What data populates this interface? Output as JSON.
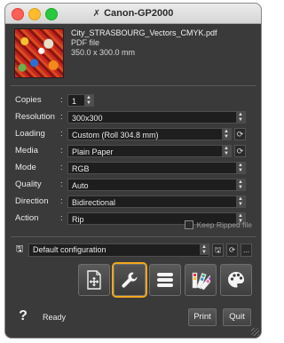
{
  "window": {
    "title": "Canon-GP2000"
  },
  "file": {
    "name": "City_STRASBOURG_Vectors_CMYK.pdf",
    "type": "PDF file",
    "size": "350.0 x 300.0 mm"
  },
  "settings": {
    "copies": {
      "label": "Copies",
      "value": "1"
    },
    "resolution": {
      "label": "Resolution",
      "value": "300x300"
    },
    "loading": {
      "label": "Loading",
      "value": "Custom (Roll 304.8 mm)"
    },
    "media": {
      "label": "Media",
      "value": "Plain Paper"
    },
    "mode": {
      "label": "Mode",
      "value": "RGB"
    },
    "quality": {
      "label": "Quality",
      "value": "Auto"
    },
    "direction": {
      "label": "Direction",
      "value": "Bidirectional"
    },
    "action": {
      "label": "Action",
      "value": "Rip"
    },
    "colon": ":"
  },
  "keep_ripped": {
    "label": "Keep Ripped file",
    "checked": false
  },
  "configuration": {
    "value": "Default configuration",
    "more_label": "..."
  },
  "tools": [
    {
      "name": "add-file-tool",
      "icon": "add-file-icon",
      "selected": false
    },
    {
      "name": "settings-tool",
      "icon": "wrench-icon",
      "selected": true
    },
    {
      "name": "queue-tool",
      "icon": "stack-icon",
      "selected": false
    },
    {
      "name": "color-swatch-tool",
      "icon": "swatch-icon",
      "selected": false
    },
    {
      "name": "palette-tool",
      "icon": "palette-icon",
      "selected": false
    }
  ],
  "footer": {
    "help": "?",
    "status": "Ready",
    "print_label": "Print",
    "quit_label": "Quit"
  },
  "colors": {
    "background": "#3a3a3a",
    "selection_accent": "#f2a81d"
  }
}
